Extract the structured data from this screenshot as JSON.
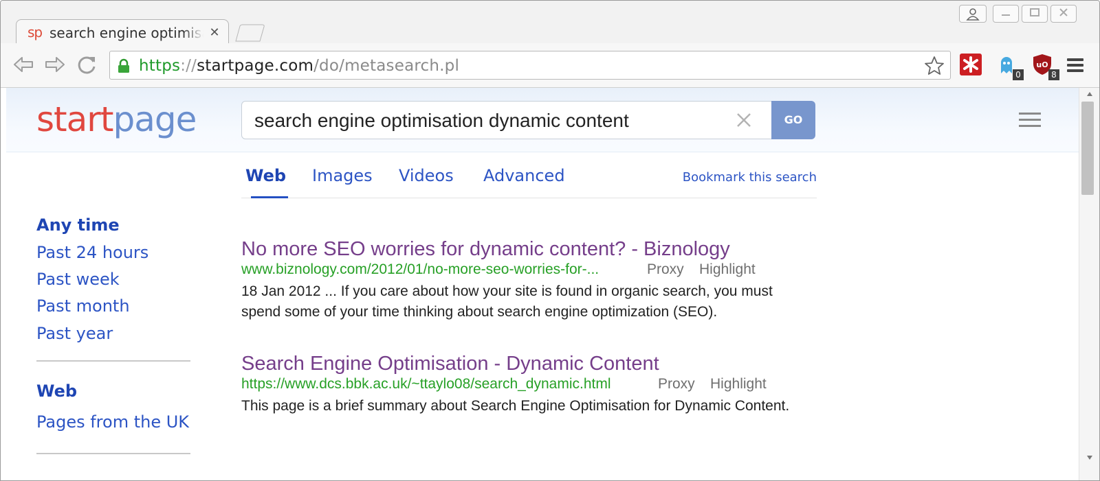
{
  "browser": {
    "tab_favicon": "sp",
    "tab_title": "search engine optimisation dynamic content",
    "url_scheme": "https",
    "url_sep": "://",
    "url_host": "startpage.com",
    "url_path": "/do/metasearch.pl",
    "extensions": [
      {
        "icon": "lastpass-icon",
        "badge": ""
      },
      {
        "icon": "ghostery-icon",
        "badge": "0"
      },
      {
        "icon": "ublock-origin-icon",
        "badge": "8"
      }
    ]
  },
  "header": {
    "logo_start": "start",
    "logo_page": "page",
    "search_value": "search engine optimisation dynamic content",
    "go_label": "GO"
  },
  "tabs": {
    "items": [
      {
        "label": "Web",
        "active": true
      },
      {
        "label": "Images",
        "active": false
      },
      {
        "label": "Videos",
        "active": false
      },
      {
        "label": "Advanced",
        "active": false
      }
    ],
    "bookmark_label": "Bookmark this search"
  },
  "sidebar": {
    "time_filters": [
      "Any time",
      "Past 24 hours",
      "Past week",
      "Past month",
      "Past year"
    ],
    "region_heading": "Web",
    "region_filter": "Pages from the UK"
  },
  "results": [
    {
      "title": "No more SEO worries for dynamic content? - Biznology",
      "url": "www.biznology.com/2012/01/no-more-seo-worries-for-...",
      "proxy_label": "Proxy",
      "highlight_label": "Highlight",
      "snippet": "18 Jan 2012 ... If you care about how your site is found in organic search, you must spend some of your time thinking about search engine optimization (SEO)."
    },
    {
      "title": "Search Engine Optimisation - Dynamic Content",
      "url": "https://www.dcs.bbk.ac.uk/~ttaylo08/search_dynamic.html",
      "proxy_label": "Proxy",
      "highlight_label": "Highlight",
      "snippet": "This page is a brief summary about Search Engine Optimisation for Dynamic Content."
    }
  ],
  "colors": {
    "link_blue": "#2c54c4",
    "visited_title": "#753e8a",
    "url_green": "#27a026",
    "logo_red": "#e0473f",
    "logo_blue": "#6b8fce",
    "go_button": "#7896cd"
  }
}
